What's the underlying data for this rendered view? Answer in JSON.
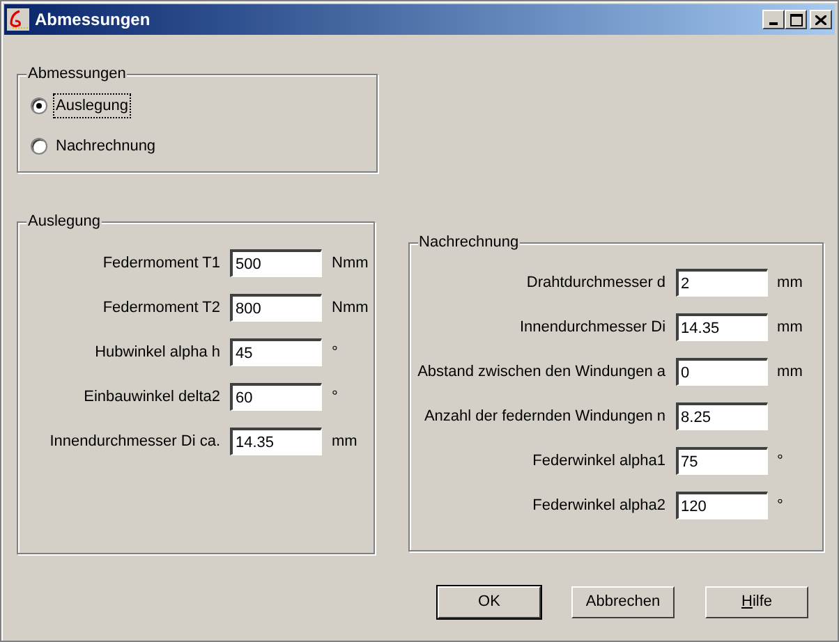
{
  "window": {
    "title": "Abmessungen"
  },
  "mode_group": {
    "title": "Abmessungen",
    "options": [
      {
        "label": "Auslegung",
        "selected": true,
        "focused": true
      },
      {
        "label": "Nachrechnung",
        "selected": false,
        "focused": false
      }
    ]
  },
  "auslegung": {
    "title": "Auslegung",
    "fields": [
      {
        "label": "Federmoment T1",
        "value": "500",
        "unit": "Nmm"
      },
      {
        "label": "Federmoment T2",
        "value": "800",
        "unit": "Nmm"
      },
      {
        "label": "Hubwinkel alpha h",
        "value": "45",
        "unit": "°"
      },
      {
        "label": "Einbauwinkel delta2",
        "value": "60",
        "unit": "°"
      },
      {
        "label": "Innendurchmesser Di ca.",
        "value": "14.35",
        "unit": "mm"
      }
    ]
  },
  "nachrechnung": {
    "title": "Nachrechnung",
    "fields": [
      {
        "label": "Drahtdurchmesser d",
        "value": "2",
        "unit": "mm"
      },
      {
        "label": "Innendurchmesser Di",
        "value": "14.35",
        "unit": "mm"
      },
      {
        "label": "Abstand zwischen den Windungen a",
        "value": "0",
        "unit": "mm"
      },
      {
        "label": "Anzahl der federnden Windungen n",
        "value": "8.25"
      },
      {
        "label": "Federwinkel alpha1",
        "value": "75",
        "unit": "°"
      },
      {
        "label": "Federwinkel alpha2",
        "value": "120",
        "unit": "°"
      }
    ]
  },
  "buttons": [
    {
      "label": "OK",
      "default": true
    },
    {
      "label": "Abbrechen",
      "default": false
    },
    {
      "label": "Hilfe",
      "default": false,
      "first_letter_underlined": true
    }
  ]
}
